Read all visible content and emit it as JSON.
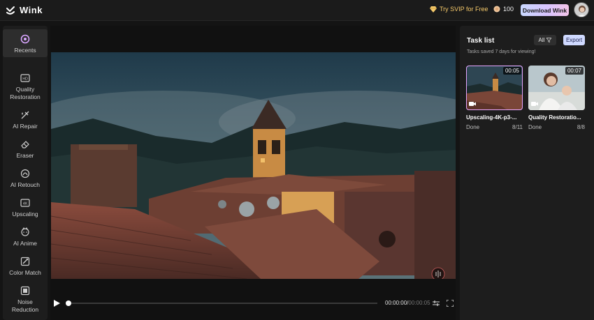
{
  "header": {
    "app_name": "Wink",
    "try_svip_label": "Try SVIP for Free",
    "credits": "100",
    "download_label": "Download Wink"
  },
  "sidebar": {
    "items": [
      {
        "label": "Recents",
        "icon": "recents-icon",
        "active": true
      },
      {
        "label": "Quality Restoration",
        "icon": "hd-icon"
      },
      {
        "label": "AI Repair",
        "icon": "ai-repair-icon"
      },
      {
        "label": "Eraser",
        "icon": "eraser-icon"
      },
      {
        "label": "AI Retouch",
        "icon": "retouch-icon"
      },
      {
        "label": "Upscaling",
        "icon": "4k-icon"
      },
      {
        "label": "AI Anime",
        "icon": "anime-icon"
      },
      {
        "label": "Color Match",
        "icon": "color-match-icon"
      },
      {
        "label": "Noise Reduction",
        "icon": "noise-icon"
      }
    ]
  },
  "player": {
    "current_time": "00:00:00",
    "separator": "/",
    "duration": "00:00:05",
    "progress": 0
  },
  "task_panel": {
    "title": "Task list",
    "subtitle": "Tasks saved 7 days for viewing!",
    "filter_label": "All",
    "export_label": "Export",
    "tasks": [
      {
        "name": "Upscaling-4K-p3-...",
        "status": "Done",
        "progress": "8/11",
        "duration": "00:05",
        "selected": true
      },
      {
        "name": "Quality Restoratio...",
        "status": "Done",
        "progress": "8/8",
        "duration": "00:07",
        "selected": false
      }
    ]
  },
  "colors": {
    "accent": "#e6a6ff",
    "svip_gold": "#f5c96a",
    "export_bg": "#cfd9ff"
  }
}
